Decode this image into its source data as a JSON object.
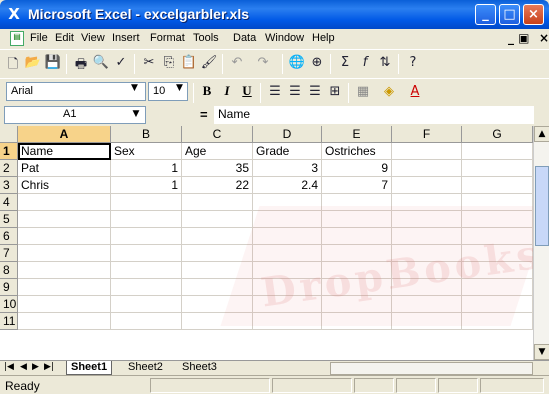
{
  "window": {
    "title": "Microsoft Excel - excelgarbler.xls"
  },
  "menu": [
    "File",
    "Edit",
    "View",
    "Insert",
    "Format",
    "Tools",
    "Data",
    "Window",
    "Help"
  ],
  "formatting": {
    "font": "Arial",
    "size": "10",
    "bold": "B",
    "italic": "I",
    "underline": "U"
  },
  "formula_bar": {
    "name_box": "A1",
    "eq": "=",
    "value": "Name"
  },
  "grid": {
    "columns": [
      "A",
      "B",
      "C",
      "D",
      "E",
      "F",
      "G"
    ],
    "rows": [
      "1",
      "2",
      "3",
      "4",
      "5",
      "6",
      "7",
      "8",
      "9",
      "10",
      "11"
    ],
    "data": [
      [
        "Name",
        "Sex",
        "Age",
        "Grade",
        "Ostriches"
      ],
      [
        "Pat",
        "1",
        "35",
        "3",
        "9"
      ],
      [
        "Chris",
        "1",
        "22",
        "2.4",
        "7"
      ]
    ]
  },
  "sheets": [
    "Sheet1",
    "Sheet2",
    "Sheet3"
  ],
  "status": "Ready",
  "watermark": "DropBooks"
}
